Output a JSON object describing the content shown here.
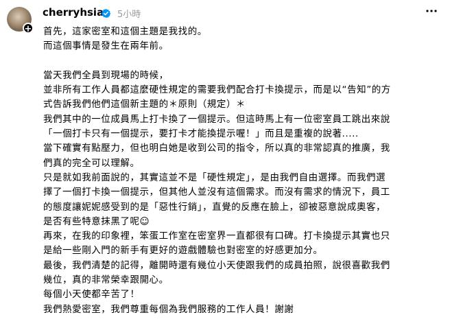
{
  "post": {
    "username": "cherryhsia",
    "time": "5小時",
    "lines": [
      "首先，這家密室和這個主題是我找的。",
      "而這個事情是發生在兩年前。",
      "",
      "當天我們全員到現場的時候，",
      "並非所有工作人員都這麼硬性規定的需要我們配合打卡換提示，而是以“告知”的方",
      "式告訴我們他們這個新主題的＊原則（規定）＊",
      "我們其中的一位成員馬上打卡換了一個提示。但這時馬上有一位密室員工跳出來說",
      "「一個打卡只有一個提示，要打卡才能換提示喔！」而且是重複的說著.....",
      "當下確實有點壓力，但也明白她是收到公司的指令，所以真的非常認真的推廣，我",
      "們真的完全可以理解。",
      "只是就如我前面說的，其實這並不是「硬性規定」，是由我們自由選擇。而我們選",
      "擇了一個打卡換一個提示，但其他人並沒有這個需求。而沒有需求的情況下，員工",
      "的態度讓妮妮感受到的是「惡性行銷」，直覺的反應在臉上，卻被惡意說成奧客，",
      "是否有些特意抹黑了呢☺",
      "再來，在我的印象裡，笨蛋工作室在密室界一直都很有口碑。打卡換提示其實也只",
      "是給一些剛入門的新手有更好的遊戲體驗也對密室的好感更加分。",
      "最後，我們清楚的記得，離開時還有幾位小天使跟我們的成員拍照，說很喜歡我們",
      "幾位，真的非常榮幸跟開心。",
      "每個小天使都辛苦了！",
      "我們熱愛密室，我們尊重每個為我們服務的工作人員！謝謝"
    ]
  },
  "icons": {
    "verified": "verified-badge-icon",
    "more": "more-options-icon",
    "follow": "plus-icon"
  },
  "colors": {
    "verified": "#0095f6",
    "time": "#999999",
    "text": "#000000"
  }
}
